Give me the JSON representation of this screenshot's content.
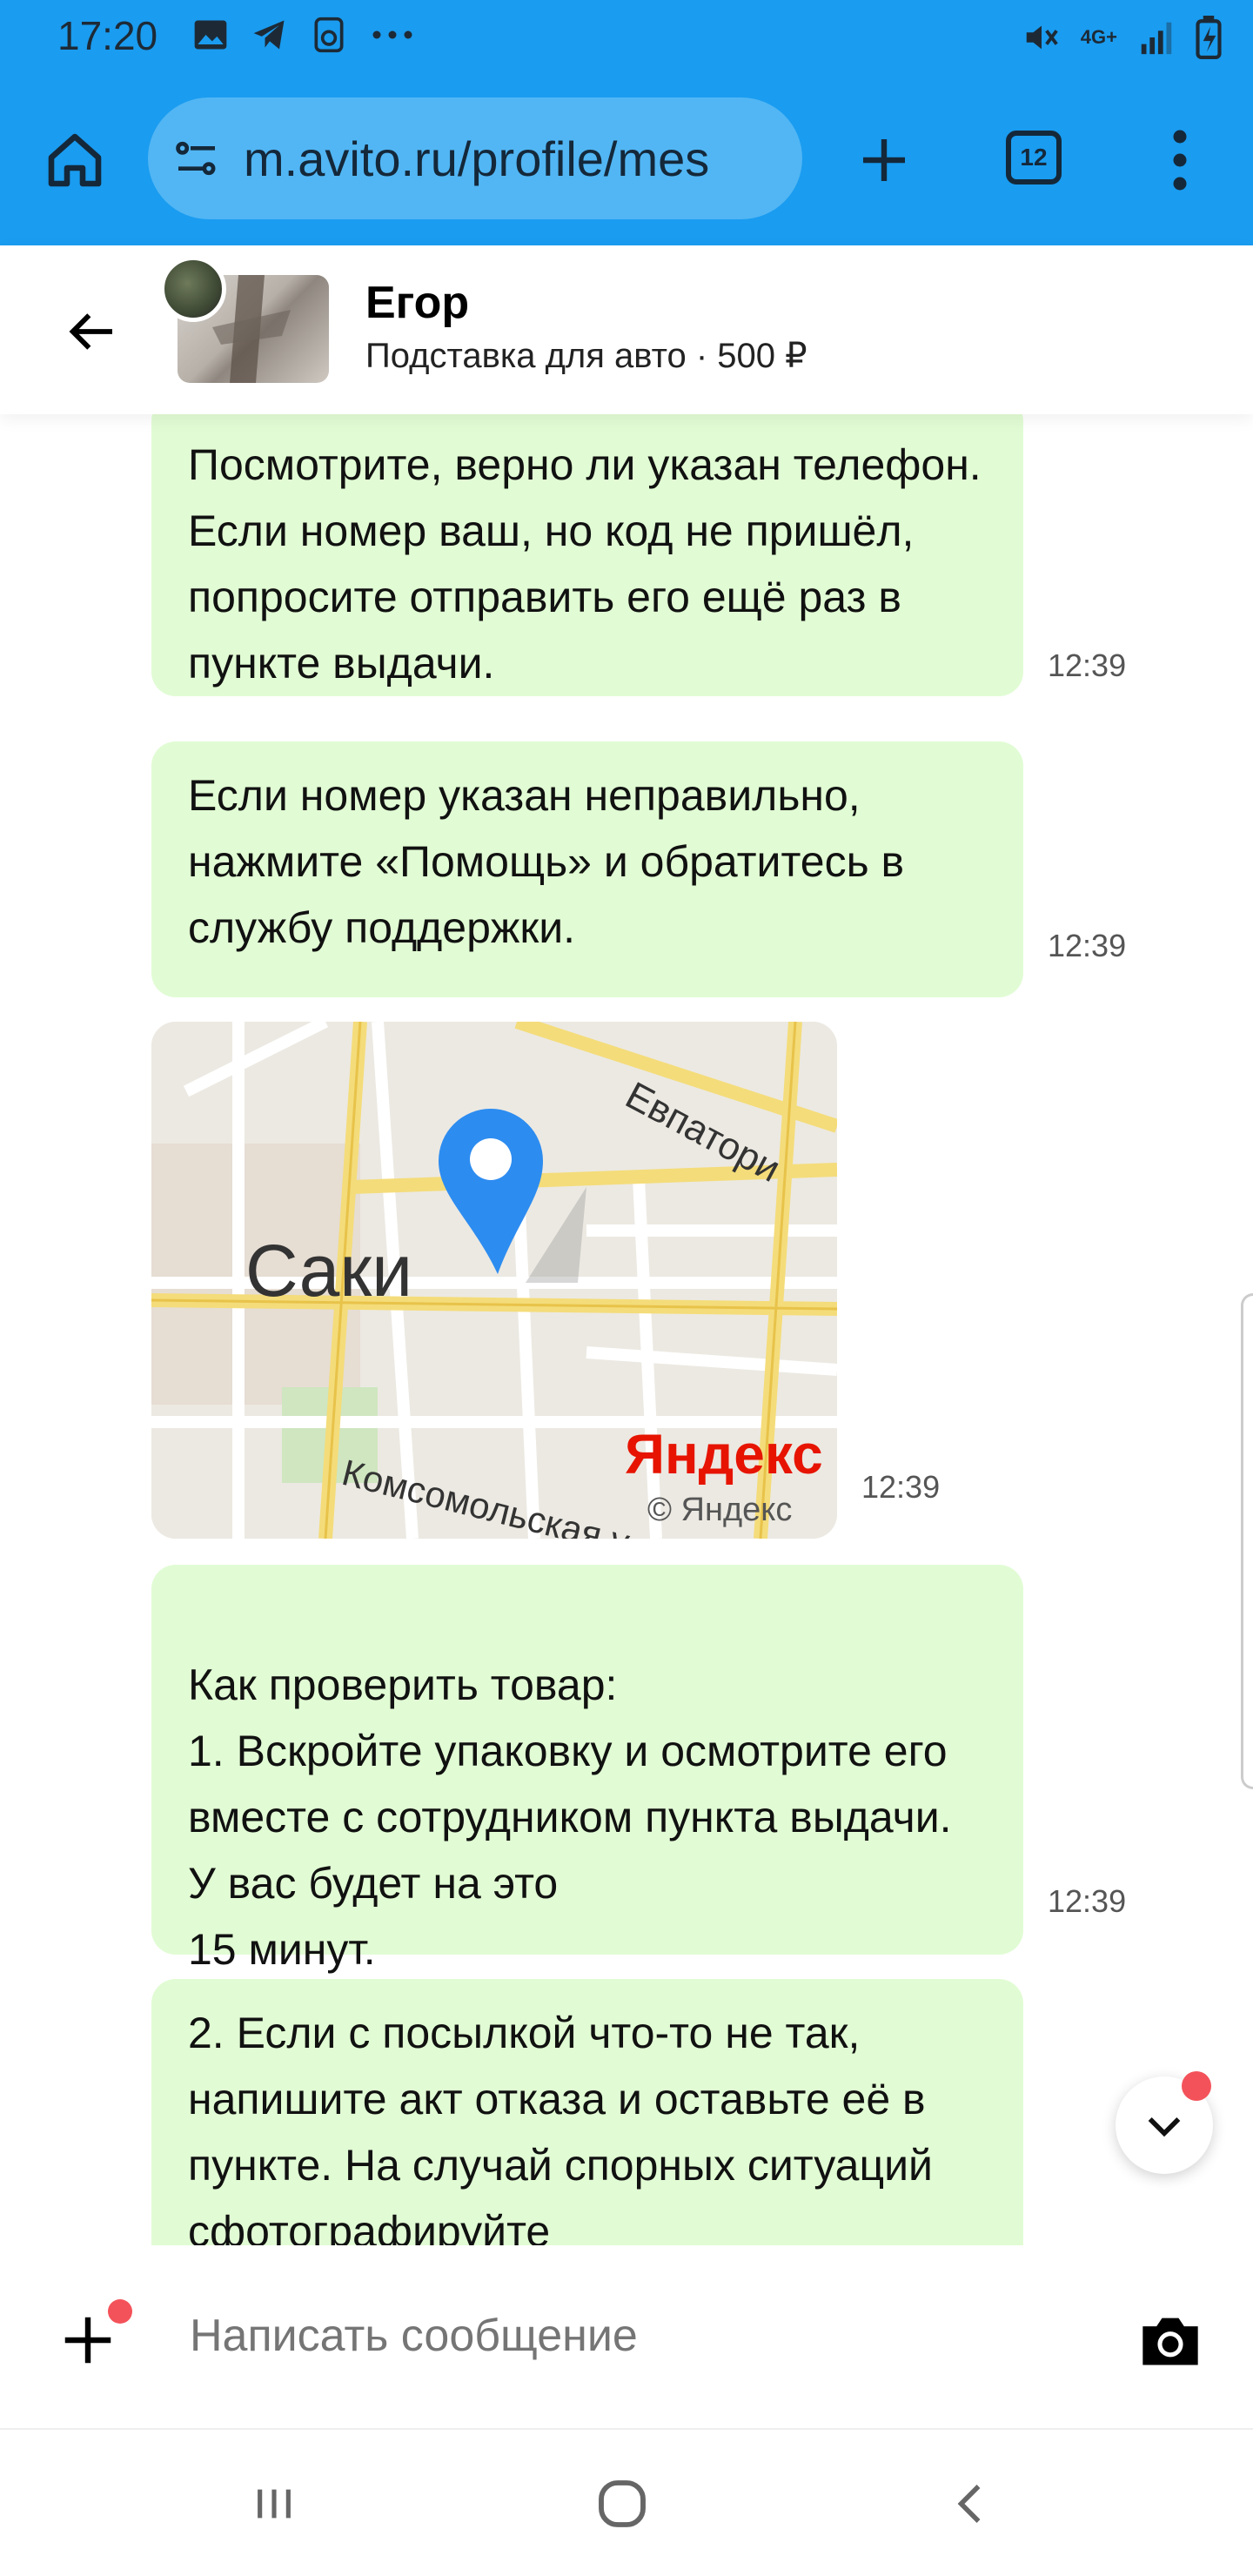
{
  "status_bar": {
    "time": "17:20",
    "left_icons": [
      "image-icon",
      "telegram-icon",
      "sim-icon",
      "more-dots-icon"
    ],
    "right_icons": [
      "mute-icon",
      "4g-icon",
      "signal-icon",
      "battery-icon"
    ],
    "network": "4G+"
  },
  "browser": {
    "url": "m.avito.ru/profile/mes",
    "tabs_count": "12"
  },
  "chat_header": {
    "contact_name": "Егор",
    "item_info": "Подставка для авто · 500 ₽"
  },
  "messages": [
    {
      "text": "Посмотрите, верно ли указан телефон. Если номер ваш, но код не пришёл, попросите отправить его ещё раз в пункте выдачи.",
      "time": "12:39"
    },
    {
      "text": "Если номер указан неправильно, нажмите «Помощь» и обратитесь в службу поддержки.",
      "time": "12:39"
    },
    {
      "type": "map",
      "city_label": "Саки",
      "street_label_1": "Евпатори",
      "street_label_2": "Комсомольская у",
      "brand": "Яндекс",
      "copyright": "© Яндекс",
      "time": "12:39"
    },
    {
      "text": "Как проверить товар:\n1. Вскройте упаковку и осмотрите его вместе с сотрудником пункта выдачи. У вас будет на это\n15 минут.",
      "time": "12:39"
    },
    {
      "text": "2. Если с посылкой что-то не так, напишите акт отказа и оставьте её в пункте. На случай спорных ситуаций сфотографируйте"
    }
  ],
  "input": {
    "placeholder": "Написать сообщение"
  },
  "colors": {
    "accent": "#1a9cf0",
    "bubble": "#e1fcd4",
    "badge": "#f4525a"
  }
}
